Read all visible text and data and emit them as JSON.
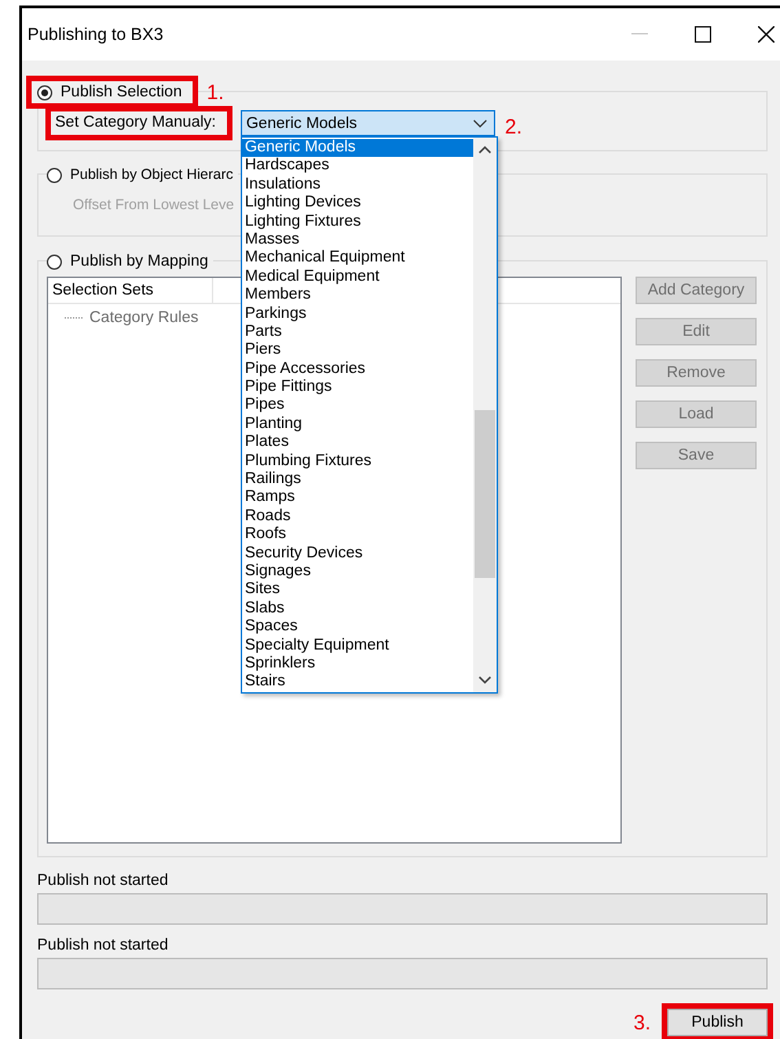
{
  "window": {
    "title": "Publishing to BX3"
  },
  "publish_selection": {
    "label": "Publish Selection",
    "selected": true,
    "highlighted": true,
    "marker": "1.",
    "category": {
      "label": "Set Category Manualy:",
      "highlighted": true,
      "marker": "2.",
      "value": "Generic Models",
      "expanded": true,
      "options": [
        {
          "label": "Generic Models",
          "selected": true
        },
        {
          "label": "Hardscapes",
          "selected": false
        },
        {
          "label": "Insulations",
          "selected": false
        },
        {
          "label": "Lighting Devices",
          "selected": false
        },
        {
          "label": "Lighting Fixtures",
          "selected": false
        },
        {
          "label": "Masses",
          "selected": false
        },
        {
          "label": "Mechanical Equipment",
          "selected": false
        },
        {
          "label": "Medical Equipment",
          "selected": false
        },
        {
          "label": "Members",
          "selected": false
        },
        {
          "label": "Parkings",
          "selected": false
        },
        {
          "label": "Parts",
          "selected": false
        },
        {
          "label": "Piers",
          "selected": false
        },
        {
          "label": "Pipe Accessories",
          "selected": false
        },
        {
          "label": "Pipe Fittings",
          "selected": false
        },
        {
          "label": "Pipes",
          "selected": false
        },
        {
          "label": "Planting",
          "selected": false
        },
        {
          "label": "Plates",
          "selected": false
        },
        {
          "label": "Plumbing Fixtures",
          "selected": false
        },
        {
          "label": "Railings",
          "selected": false
        },
        {
          "label": "Ramps",
          "selected": false
        },
        {
          "label": "Roads",
          "selected": false
        },
        {
          "label": "Roofs",
          "selected": false
        },
        {
          "label": "Security Devices",
          "selected": false
        },
        {
          "label": "Signages",
          "selected": false
        },
        {
          "label": "Sites",
          "selected": false
        },
        {
          "label": "Slabs",
          "selected": false
        },
        {
          "label": "Spaces",
          "selected": false
        },
        {
          "label": "Specialty Equipment",
          "selected": false
        },
        {
          "label": "Sprinklers",
          "selected": false
        },
        {
          "label": "Stairs",
          "selected": false
        }
      ]
    }
  },
  "publish_by_hierarchy": {
    "label": "Publish by Object Hierarc",
    "selected": false,
    "offset_label": "Offset From Lowest Leve",
    "offset_disabled": true
  },
  "publish_by_mapping": {
    "label": "Publish by Mapping",
    "selected": false,
    "tree": {
      "header": "Selection Sets",
      "items": [
        {
          "label": "Category Rules",
          "disabled": true
        }
      ]
    },
    "buttons": [
      {
        "label": "Add Category",
        "disabled": true
      },
      {
        "label": "Edit",
        "disabled": true
      },
      {
        "label": "Remove",
        "disabled": true
      },
      {
        "label": "Load",
        "disabled": true
      },
      {
        "label": "Save",
        "disabled": true
      }
    ]
  },
  "status": [
    {
      "label": "Publish not started",
      "level": 0
    },
    {
      "label": "Publish not started",
      "level": 0
    }
  ],
  "publish_button": {
    "label": "Publish",
    "disabled": false,
    "highlighted": true,
    "marker": "3."
  }
}
